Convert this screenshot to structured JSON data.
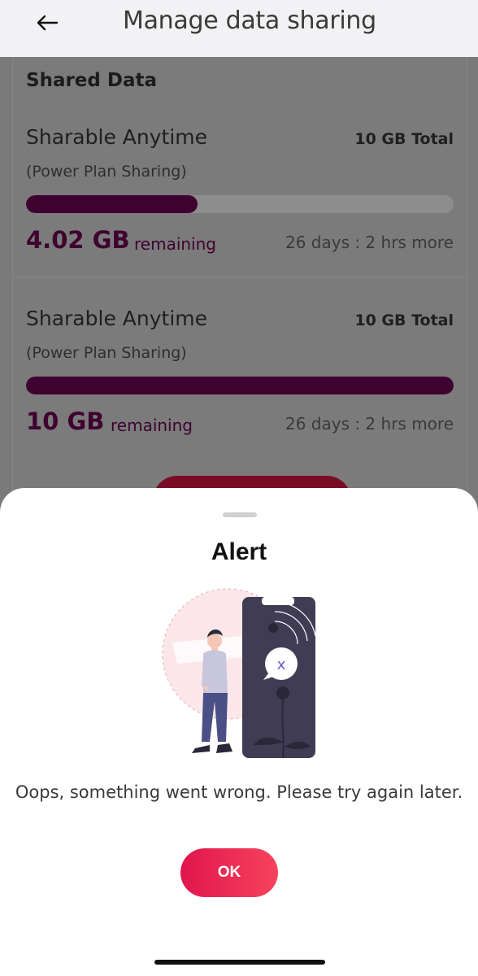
{
  "header": {
    "title": "Manage data sharing",
    "back_icon": "arrow-left-icon"
  },
  "shared": {
    "title": "Shared Data",
    "plans": [
      {
        "name": "Sharable Anytime",
        "total": "10 GB Total",
        "subtitle": "(Power Plan Sharing)",
        "remaining_amount": "4.02 GB",
        "remaining_label": "remaining",
        "time_left": "26 days : 2 hrs more",
        "fill_fraction": 0.402
      },
      {
        "name": "Sharable Anytime",
        "total": "10 GB Total",
        "subtitle": "(Power Plan Sharing)",
        "remaining_amount": "10 GB",
        "remaining_label": "remaining",
        "time_left": "26 days : 2 hrs more",
        "fill_fraction": 1.0
      }
    ]
  },
  "alert": {
    "title": "Alert",
    "message": "Oops, something went wrong. Please try again later.",
    "ok_label": "OK",
    "illustration_icon": "person-phone-error-icon"
  },
  "colors": {
    "accent": "#3f0230",
    "button_start": "#e0154d",
    "button_end": "#f7435d"
  }
}
